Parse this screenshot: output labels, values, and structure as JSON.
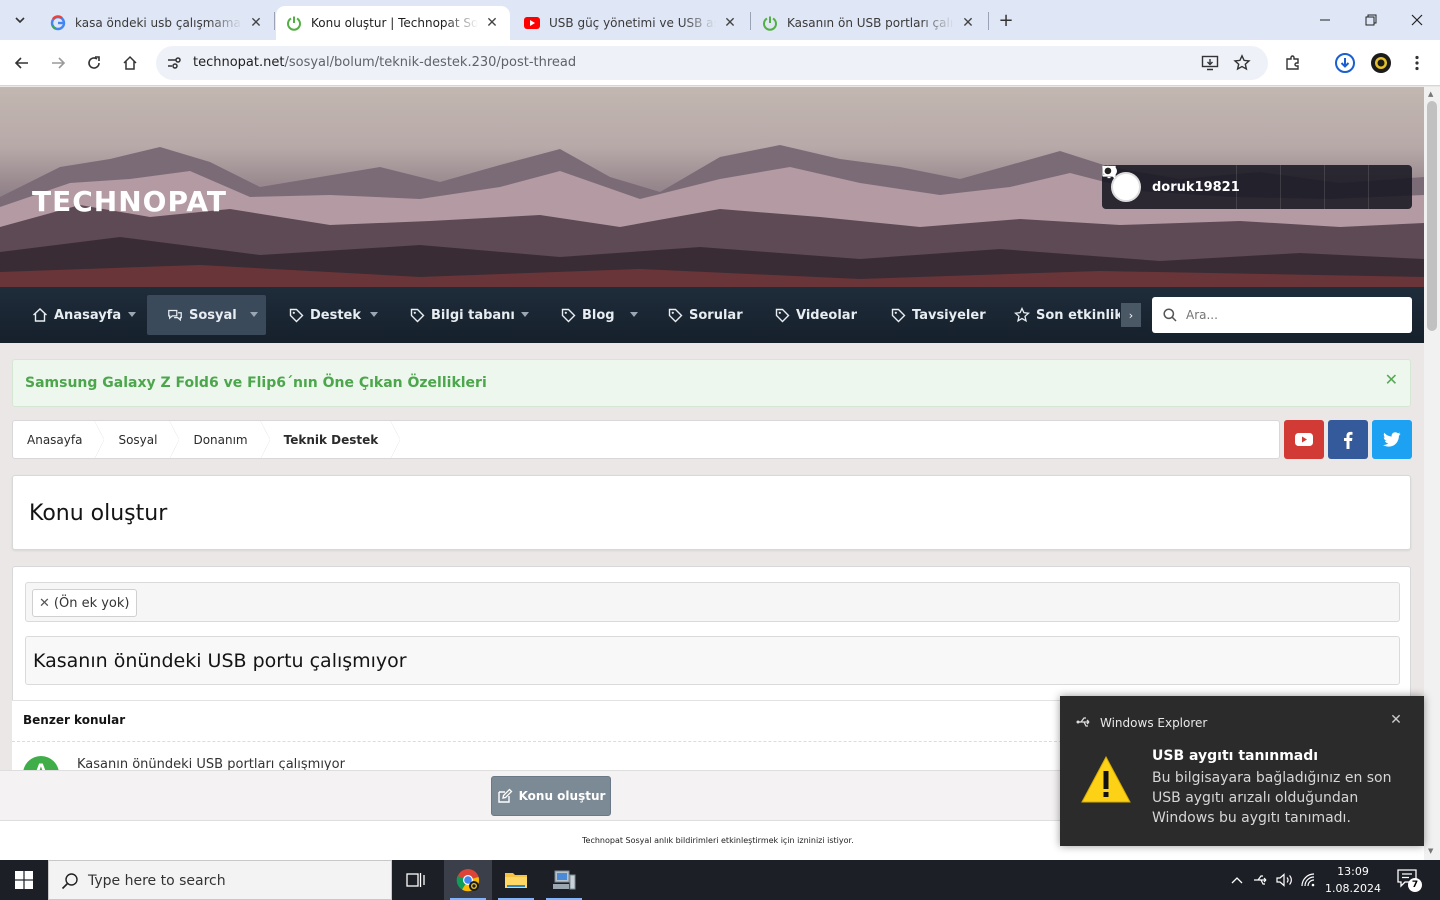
{
  "browser": {
    "tabs": [
      {
        "title": "kasa öndeki usb çalışmama sorunu",
        "favicon": "google-icon"
      },
      {
        "title": "Konu oluştur | Technopat Sosyal",
        "favicon": "technopat-icon",
        "active": true
      },
      {
        "title": "USB güç yönetimi ve USB askıya alma",
        "favicon": "youtube-icon"
      },
      {
        "title": "Kasanın ön USB portları çalışmıyor",
        "favicon": "technopat-icon"
      }
    ],
    "url_host": "technopat.net",
    "url_path": "/sosyal/bolum/teknik-destek.230/post-thread"
  },
  "site": {
    "logo": "TECHNOPAT",
    "username": "doruk19821",
    "nav": [
      {
        "label": "Anasayfa",
        "icon": "home-icon",
        "dropdown": true
      },
      {
        "label": "Sosyal",
        "icon": "chat-icon",
        "dropdown": true,
        "selected": true
      },
      {
        "label": "Destek",
        "icon": "tag-icon",
        "dropdown": true
      },
      {
        "label": "Bilgi tabanı",
        "icon": "tag-icon",
        "dropdown": true
      },
      {
        "label": "Blog",
        "icon": "tag-icon",
        "dropdown": true
      },
      {
        "label": "Sorular",
        "icon": "tag-icon"
      },
      {
        "label": "Videolar",
        "icon": "tag-icon"
      },
      {
        "label": "Tavsiyeler",
        "icon": "tag-icon"
      },
      {
        "label": "Son etkinlik",
        "icon": "star-icon"
      }
    ],
    "search_placeholder": "Ara...",
    "notice": "Samsung Galaxy Z Fold6 ve Flip6´nın Öne Çıkan Özellikleri",
    "breadcrumbs": [
      "Anasayfa",
      "Sosyal",
      "Donanım",
      "Teknik Destek"
    ],
    "social_colors": {
      "youtube": "#d23a36",
      "facebook": "#345a9c",
      "twitter": "#1da1f2"
    },
    "accent": "#4ca64c"
  },
  "form": {
    "page_title": "Konu oluştur",
    "prefix": "(Ön ek yok)",
    "thread_title": "Kasanın önündeki USB portu çalışmıyor",
    "similar_heading": "Benzer konular",
    "similar_items": [
      {
        "avatar_letter": "A",
        "title": "Kasanın önündeki USB portları çalışmıyor"
      }
    ],
    "submit_label": "Konu oluştur",
    "push_text": "Technopat Sosyal anlık bildirimleri etkinleştirmek için izninizi istiyor."
  },
  "toast": {
    "app": "Windows Explorer",
    "title": "USB aygıtı tanınmadı",
    "body": "Bu bilgisayara bağladığınız en son USB aygıtı arızalı olduğundan Windows bu aygıtı tanımadı."
  },
  "taskbar": {
    "search_placeholder": "Type here to search",
    "time": "13:09",
    "date": "1.08.2024",
    "notification_count": "7"
  }
}
